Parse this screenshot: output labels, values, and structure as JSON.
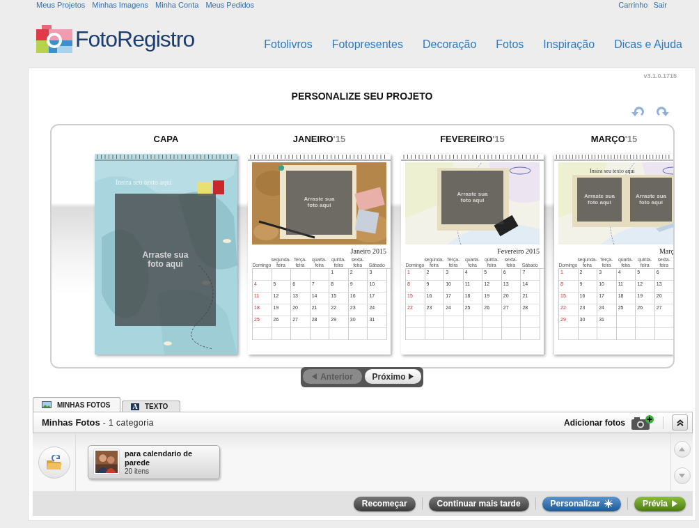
{
  "top_links": [
    "Meus Projetos",
    "Minhas Imagens",
    "Minha Conta",
    "Meus Pedidos"
  ],
  "account_links": [
    "Carrinho",
    "Sair"
  ],
  "logo": {
    "text": "FotoRegistro"
  },
  "nav": [
    "Fotolivros",
    "Fotopresentes",
    "Decoração",
    "Fotos",
    "Inspiração",
    "Dicas e Ajuda"
  ],
  "version": "v3.1.0.1715",
  "title": "PERSONALIZE SEU PROJETO",
  "pages": [
    {
      "kind": "cover",
      "label": "CAPA",
      "cut": false,
      "text_placeholder": "Insira seu texto aqui",
      "photo_slots": [
        "Arraste sua foto aqui"
      ]
    },
    {
      "kind": "month",
      "label": "JANEIRO",
      "year": "'15",
      "cut": false,
      "photo_slots": [
        "Arraste sua foto aqui"
      ],
      "calendar_title": "Janeiro 2015",
      "weekdays": [
        "Domingo",
        "segunda-feira",
        "Terça-feira",
        "quarta-feira",
        "quinta-feira",
        "sexta-feira",
        "Sábado"
      ],
      "weeks": [
        {
          "thu": "1",
          "fri": "2",
          "sat": "3"
        },
        {
          "sun": "4",
          "mon": "5",
          "tue": "6",
          "wed": "7",
          "thu": "8",
          "fri": "9",
          "sat": "10"
        },
        {
          "sun": "11",
          "mon": "12",
          "tue": "13",
          "wed": "14",
          "thu": "15",
          "fri": "16",
          "sat": "17"
        },
        {
          "sun": "18",
          "mon": "19",
          "tue": "20",
          "wed": "21",
          "thu": "22",
          "fri": "23",
          "sat": "24"
        },
        {
          "sun": "25",
          "mon": "26",
          "tue": "27",
          "wed": "28",
          "thu": "29",
          "fri": "30",
          "sat": "31"
        }
      ]
    },
    {
      "kind": "month",
      "label": "FEVEREIRO",
      "year": "'15",
      "cut": false,
      "photo_slots": [
        "Arraste sua foto aqui"
      ],
      "calendar_title": "Fevereiro 2015",
      "weekdays": [
        "Domingo",
        "segunda-feira",
        "Terça-feira",
        "quarta-feira",
        "quinta-feira",
        "sexta-feira",
        "Sábado"
      ],
      "weeks": [
        {
          "sun": "1",
          "mon": "2",
          "tue": "3",
          "wed": "4",
          "thu": "5",
          "fri": "6",
          "sat": "7"
        },
        {
          "sun": "8",
          "mon": "9",
          "tue": "10",
          "wed": "11",
          "thu": "12",
          "fri": "13",
          "sat": "14"
        },
        {
          "sun": "15",
          "mon": "16",
          "tue": "17",
          "wed": "18",
          "thu": "19",
          "fri": "20",
          "sat": "21"
        },
        {
          "sun": "22",
          "mon": "23",
          "tue": "24",
          "wed": "25",
          "thu": "26",
          "fri": "27",
          "sat": "28"
        }
      ]
    },
    {
      "kind": "month",
      "label": "MARÇO",
      "year": "'15",
      "cut": true,
      "text_placeholder": "Insira seu texto aqui",
      "photo_slots": [
        "Arraste sua foto aqui",
        "Arraste sua foto aqui"
      ],
      "calendar_title": "Març",
      "weekdays": [
        "Domingo",
        "segunda-feira",
        "Terça-feira",
        "quarta-feira",
        "quinta-feira",
        "sexta-feira"
      ],
      "weeks": [
        {
          "sun": "1",
          "mon": "2",
          "tue": "3",
          "wed": "4",
          "thu": "5",
          "fri": "6"
        },
        {
          "sun": "8",
          "mon": "9",
          "tue": "10",
          "wed": "11",
          "thu": "12",
          "fri": "13"
        },
        {
          "sun": "15",
          "mon": "16",
          "tue": "17",
          "wed": "18",
          "thu": "19",
          "fri": "20"
        },
        {
          "sun": "22",
          "mon": "23",
          "tue": "24",
          "wed": "25",
          "thu": "26",
          "fri": "27"
        },
        {
          "sun": "29",
          "mon": "30",
          "tue": "31"
        }
      ]
    }
  ],
  "pager": [
    {
      "kind": "prev",
      "label": "Anterior",
      "disabled": true
    },
    {
      "kind": "next",
      "label": "Próximo",
      "disabled": false
    }
  ],
  "tabs": [
    {
      "kind": "photos",
      "label": "MINHAS FOTOS",
      "selected": true
    },
    {
      "kind": "text",
      "glyph": "A",
      "label": "TEXTO",
      "selected": false
    }
  ],
  "photos_panel": {
    "title": "Minhas Fotos",
    "subtitle": "- 1 categoria",
    "add_label": "Adicionar fotos",
    "folders": [
      {
        "name": "para calendario de parede",
        "count": "20 itens"
      }
    ]
  },
  "actions": [
    {
      "kind": "dark",
      "label": "Recomeçar"
    },
    {
      "kind": "dark",
      "label": "Continuar mais tarde"
    },
    {
      "kind": "blue",
      "label": "Personalizar"
    },
    {
      "kind": "green",
      "label": "Prévia"
    }
  ]
}
